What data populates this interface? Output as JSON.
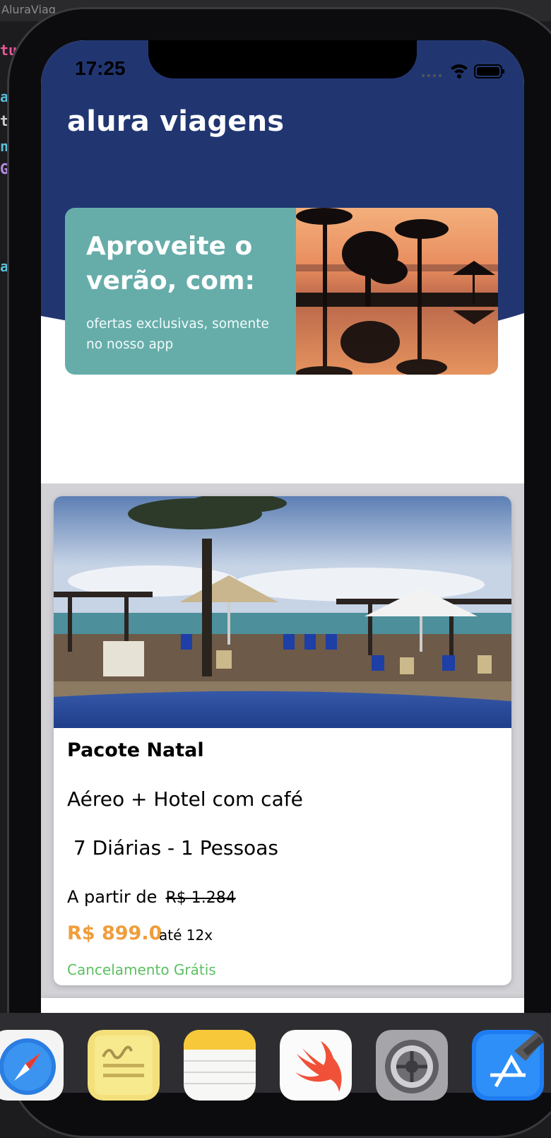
{
  "xcode": {
    "window_title": "AluraViag",
    "gutter_letters": [
      "tu",
      "a",
      "t",
      "n",
      "G",
      "a"
    ]
  },
  "status_bar": {
    "time": "17:25"
  },
  "header": {
    "title": "alura viagens",
    "accent_color": "#213671"
  },
  "banner": {
    "title": "Aproveite o verão, com:",
    "subtitle": "ofertas exclusivas, somente no nosso app",
    "background_color": "#66adaa"
  },
  "package_card": {
    "title": "Pacote Natal",
    "description": "Aéreo + Hotel com café",
    "details": " 7 Diárias - 1 Pessoas",
    "from_label": "A partir de",
    "old_price": "R$ 1.284",
    "price": "R$ 899.0",
    "installments": "até 12x",
    "cancellation": "Cancelamento Grátis",
    "price_color": "#f09d3b",
    "cancellation_color": "#5cbf61"
  },
  "dock": {
    "apps": [
      "safari-icon",
      "stickies-icon",
      "notes-icon",
      "swift-playgrounds-icon",
      "system-preferences-icon",
      "xcode-icon"
    ]
  }
}
